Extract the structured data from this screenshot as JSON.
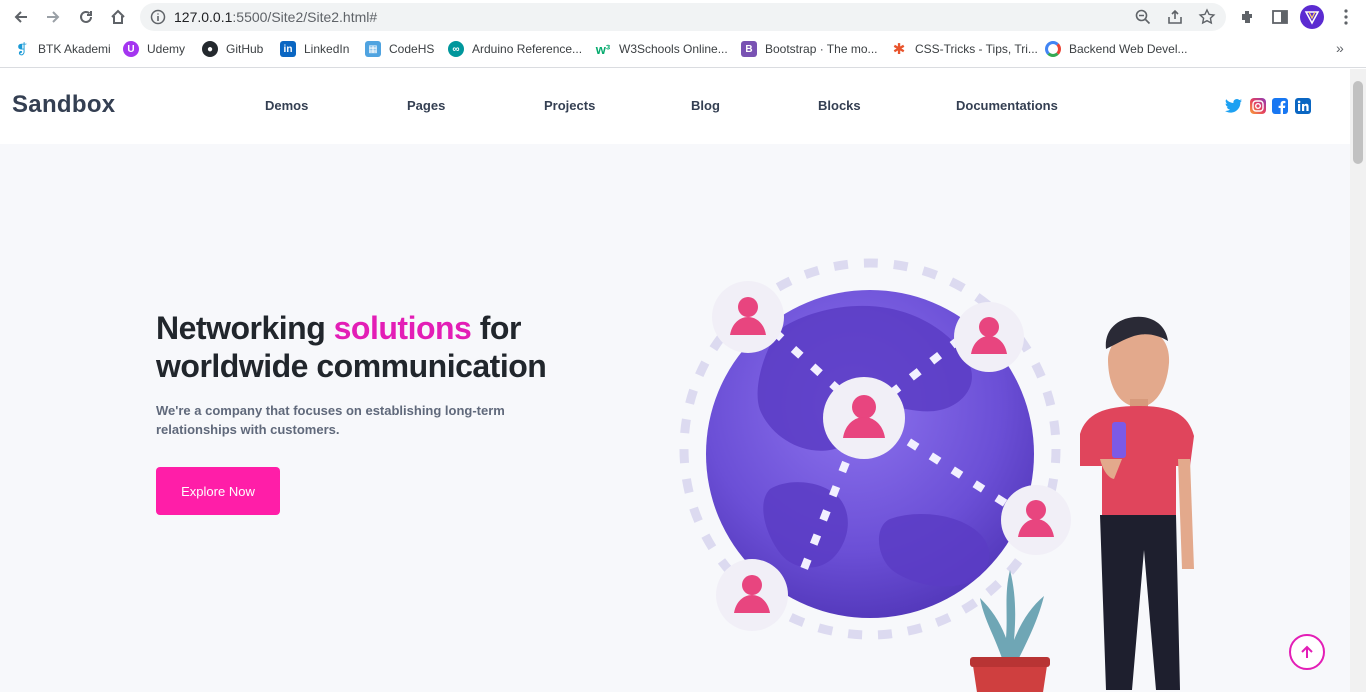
{
  "browser": {
    "url_host": "127.0.0.1",
    "url_path": ":5500/Site2/Site2.html#",
    "bookmarks": [
      {
        "label": "BTK Akademi",
        "icon": "btk-icon",
        "color": "#1a9ad6"
      },
      {
        "label": "Udemy",
        "icon": "udemy-icon",
        "color": "#a435f0"
      },
      {
        "label": "GitHub",
        "icon": "github-icon",
        "color": "#24292e"
      },
      {
        "label": "LinkedIn",
        "icon": "linkedin-icon",
        "color": "#0a66c2"
      },
      {
        "label": "CodeHS",
        "icon": "codehs-icon",
        "color": "#4fa3e0"
      },
      {
        "label": "Arduino Reference...",
        "icon": "arduino-icon",
        "color": "#00979c"
      },
      {
        "label": "W3Schools Online...",
        "icon": "w3schools-icon",
        "color": "#04aa6d"
      },
      {
        "label": "Bootstrap · The mo...",
        "icon": "bootstrap-icon",
        "color": "#7952b3"
      },
      {
        "label": "CSS-Tricks - Tips, Tri...",
        "icon": "csstricks-icon",
        "color": "#e8542c"
      },
      {
        "label": "Backend Web Devel...",
        "icon": "google-icon",
        "color": "#4285f4"
      }
    ]
  },
  "site": {
    "logo": "Sandbox",
    "nav": [
      "Demos",
      "Pages",
      "Projects",
      "Blog",
      "Blocks",
      "Documentations"
    ],
    "social": [
      {
        "name": "twitter-icon",
        "color": "#1da1f2"
      },
      {
        "name": "instagram-icon",
        "color": "#e4405f"
      },
      {
        "name": "facebook-icon",
        "color": "#1877f2"
      },
      {
        "name": "linkedin-icon",
        "color": "#0a66c2"
      }
    ]
  },
  "hero": {
    "title_part1": "Networking ",
    "title_accent": "solutions",
    "title_part2": " for",
    "title_line2": "worldwide communication",
    "subtitle": "We're a company that focuses on establishing long-term relationships with customers.",
    "cta_label": "Explore Now"
  },
  "colors": {
    "accent": "#e31eb6",
    "button": "#ff1ea8",
    "text_dark": "#21262c",
    "globe": "#6a4fd0"
  }
}
